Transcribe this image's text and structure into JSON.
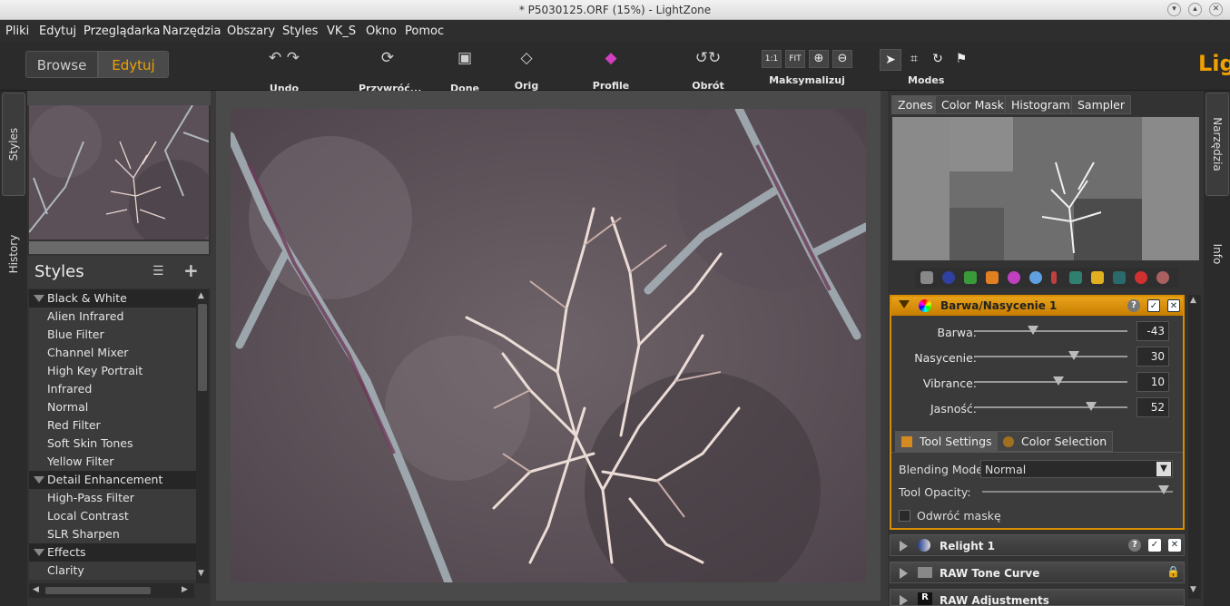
{
  "window": {
    "title": "* P5030125.ORF (15%) - LightZone"
  },
  "menu": [
    "Pliki",
    "Edytuj",
    "Przeglądarka",
    "Narzędzia",
    "Obszary",
    "Styles",
    "VK_S",
    "Okno",
    "Pomoc"
  ],
  "toolbar": {
    "browse": "Browse",
    "edit": "Edytuj",
    "undo_redo": "Undo Redo",
    "revert": "Przywróć...",
    "done": "Done",
    "orig": "Orig",
    "color_profiles": "Profile kolorów",
    "rotate": "Obrót",
    "maximize": "Maksymalizuj",
    "modes": "Modes",
    "zoom_1to1": "1:1",
    "zoom_fit": "FIT",
    "brand": "Lig"
  },
  "left_tabs": {
    "styles": "Styles",
    "history": "History"
  },
  "styles_panel": {
    "title": "Styles",
    "items": [
      {
        "label": "Black & White",
        "group": true
      },
      {
        "label": "Alien Infrared",
        "group": false
      },
      {
        "label": "Blue Filter",
        "group": false
      },
      {
        "label": "Channel Mixer",
        "group": false
      },
      {
        "label": "High Key Portrait",
        "group": false
      },
      {
        "label": "Infrared",
        "group": false
      },
      {
        "label": "Normal",
        "group": false
      },
      {
        "label": "Red Filter",
        "group": false
      },
      {
        "label": "Soft Skin Tones",
        "group": false
      },
      {
        "label": "Yellow Filter",
        "group": false
      },
      {
        "label": "Detail Enhancement",
        "group": true
      },
      {
        "label": "High-Pass Filter",
        "group": false
      },
      {
        "label": "Local Contrast",
        "group": false
      },
      {
        "label": "SLR Sharpen",
        "group": false
      },
      {
        "label": "Effects",
        "group": true
      },
      {
        "label": "Clarity",
        "group": false
      }
    ]
  },
  "right_tabs": [
    "Zones",
    "Color Mask",
    "Histogram",
    "Sampler"
  ],
  "right_strip": {
    "tools": "Narzędzia",
    "info": "Info"
  },
  "hue_sat_tool": {
    "title": "Barwa/Nasycenie 1",
    "sliders": [
      {
        "label": "Barwa:",
        "value": "-43",
        "pos": 0.38
      },
      {
        "label": "Nasycenie:",
        "value": "30",
        "pos": 0.65
      },
      {
        "label": "Vibrance:",
        "value": "10",
        "pos": 0.55
      },
      {
        "label": "Jasność:",
        "value": "52",
        "pos": 0.76
      }
    ],
    "tab_tool_settings": "Tool Settings",
    "tab_color_selection": "Color Selection",
    "blending_label": "Blending Mode:",
    "blending_value": "Normal",
    "opacity_label": "Tool Opacity:",
    "opacity_value": 1.0,
    "invert_mask": "Odwróć maskę"
  },
  "stack": [
    "Relight 1",
    "RAW Tone Curve",
    "RAW Adjustments"
  ],
  "colors": {
    "accent": "#d98c00",
    "brand": "#f0a000"
  }
}
